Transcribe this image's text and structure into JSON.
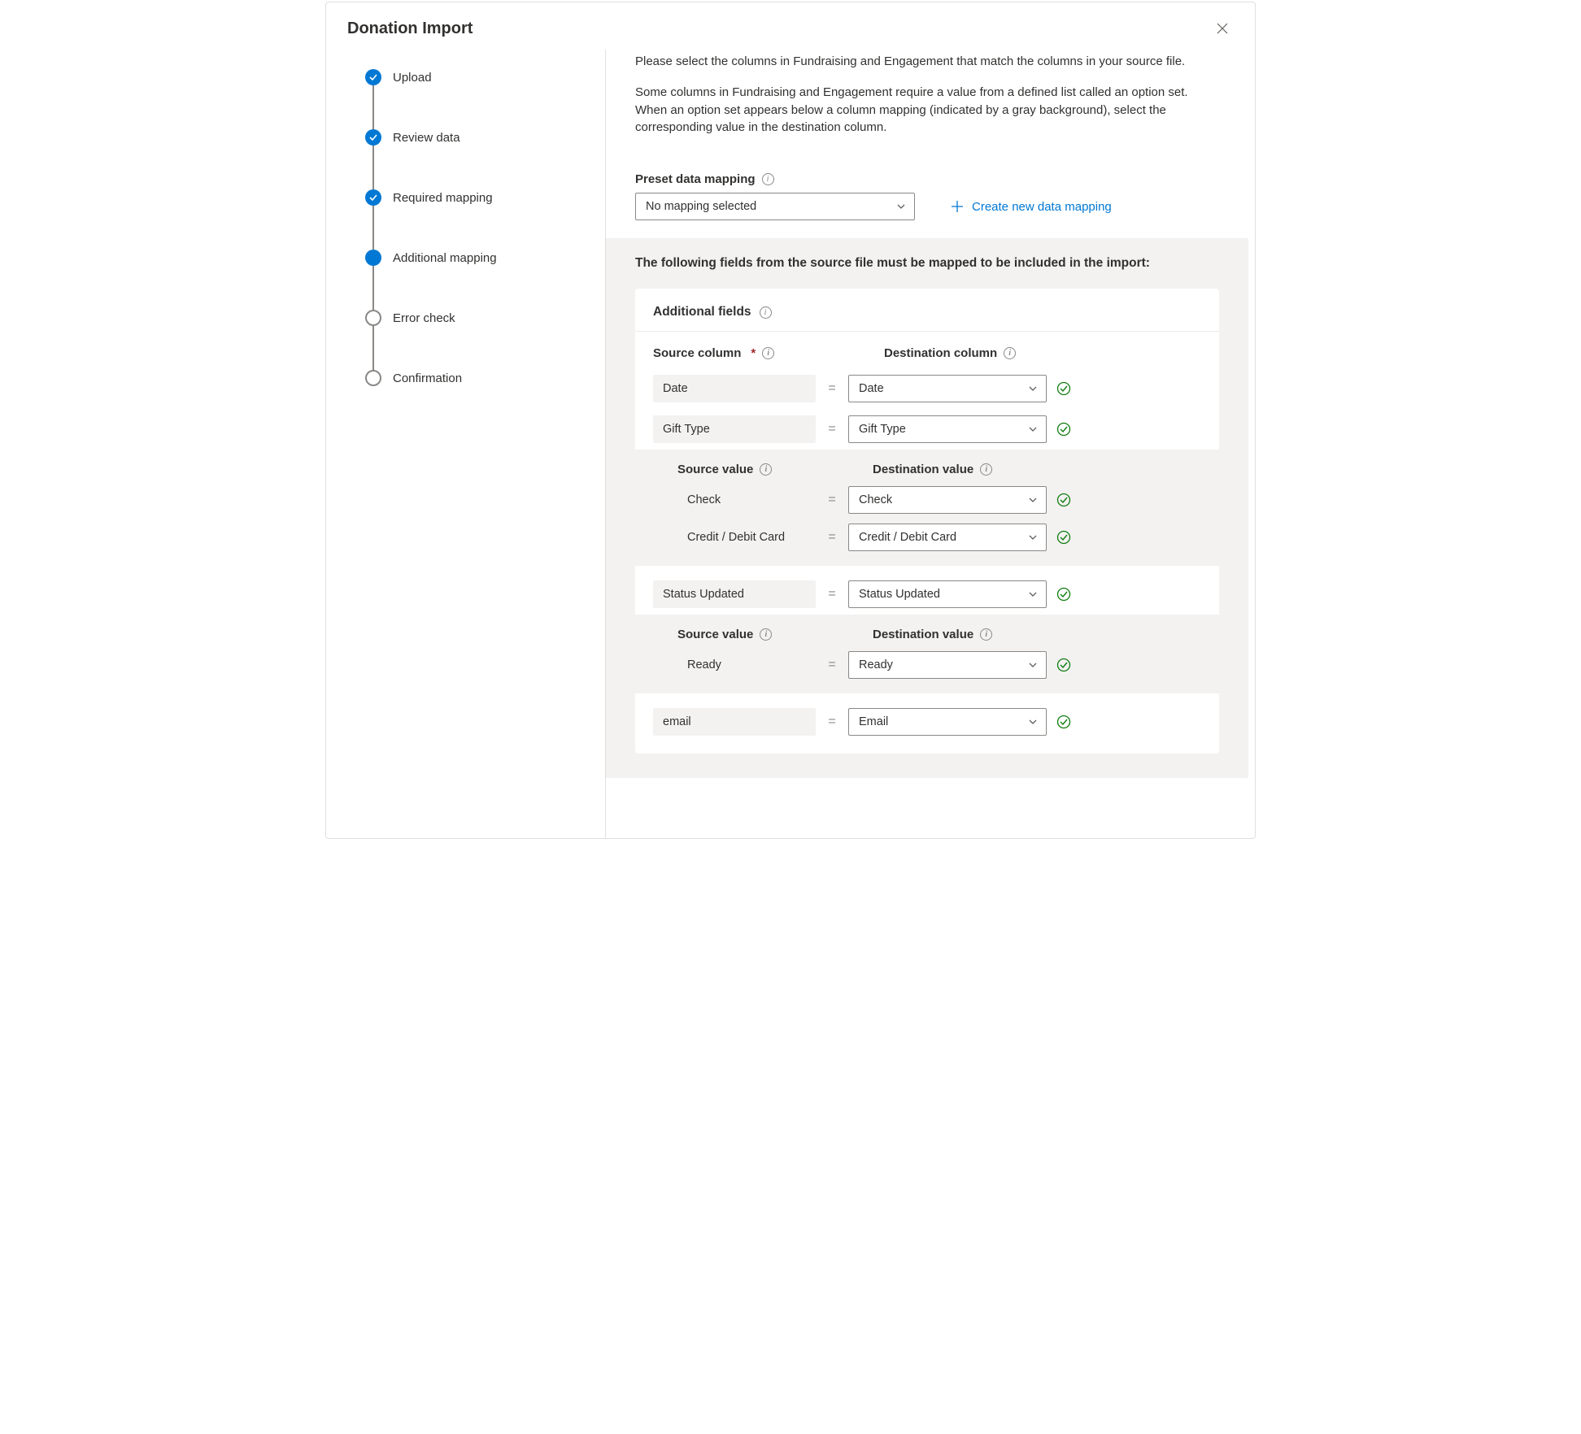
{
  "dialog": {
    "title": "Donation Import"
  },
  "steps": [
    {
      "label": "Upload",
      "state": "done"
    },
    {
      "label": "Review data",
      "state": "done"
    },
    {
      "label": "Required mapping",
      "state": "done"
    },
    {
      "label": "Additional mapping",
      "state": "current"
    },
    {
      "label": "Error check",
      "state": "upcoming"
    },
    {
      "label": "Confirmation",
      "state": "upcoming"
    }
  ],
  "intro": {
    "p1": "Please select the columns in Fundraising and Engagement that match the columns in your source file.",
    "p2": "Some columns in Fundraising and Engagement require a value from a defined list called an option set. When an option set appears below a column mapping (indicated by a gray background), select the corresponding value in the destination column."
  },
  "preset": {
    "label": "Preset data mapping",
    "selected": "No mapping selected",
    "create_label": "Create new data mapping"
  },
  "panel": {
    "title": "The following fields from the source file must be mapped to be included in the import:",
    "card_title": "Additional fields",
    "src_header": "Source column",
    "dst_header": "Destination column",
    "srcval_header": "Source value",
    "dstval_header": "Destination value",
    "rows": [
      {
        "src": "Date",
        "dst": "Date"
      },
      {
        "src": "Gift Type",
        "dst": "Gift Type"
      },
      {
        "src": "Status Updated",
        "dst": "Status Updated"
      },
      {
        "src": "email",
        "dst": "Email"
      }
    ],
    "option_groups": {
      "gift_type": [
        {
          "src": "Check",
          "dst": "Check"
        },
        {
          "src": "Credit / Debit Card",
          "dst": "Credit / Debit Card"
        }
      ],
      "status_updated": [
        {
          "src": "Ready",
          "dst": "Ready"
        }
      ]
    }
  }
}
